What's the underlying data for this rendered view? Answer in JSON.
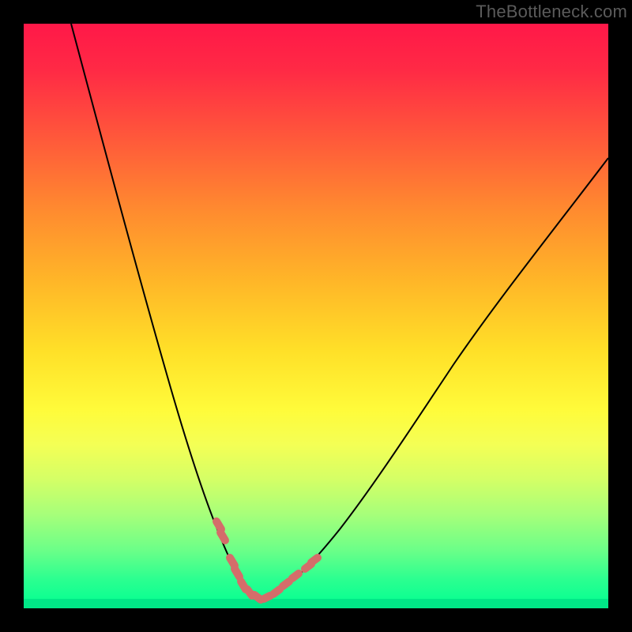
{
  "watermark": "TheBottleneck.com",
  "chart_data": {
    "type": "line",
    "title": "",
    "xlabel": "",
    "ylabel": "",
    "xlim": [
      0,
      740
    ],
    "ylim": [
      0,
      740
    ],
    "grid": false,
    "legend": false,
    "background_gradient": {
      "direction": "vertical",
      "stops": [
        {
          "pos": 0.0,
          "color": "#ff1848"
        },
        {
          "pos": 0.08,
          "color": "#ff2a45"
        },
        {
          "pos": 0.2,
          "color": "#ff5a3a"
        },
        {
          "pos": 0.32,
          "color": "#ff8b2f"
        },
        {
          "pos": 0.44,
          "color": "#ffb628"
        },
        {
          "pos": 0.56,
          "color": "#ffe028"
        },
        {
          "pos": 0.66,
          "color": "#fffb3a"
        },
        {
          "pos": 0.72,
          "color": "#f4ff55"
        },
        {
          "pos": 0.78,
          "color": "#d4ff66"
        },
        {
          "pos": 0.84,
          "color": "#a6ff7a"
        },
        {
          "pos": 0.9,
          "color": "#6cff88"
        },
        {
          "pos": 0.95,
          "color": "#2cff90"
        },
        {
          "pos": 1.0,
          "color": "#00ff92"
        }
      ]
    },
    "series": [
      {
        "name": "v-curve",
        "x": [
          60,
          100,
          140,
          180,
          210,
          235,
          258,
          273,
          286,
          300,
          320,
          350,
          400,
          460,
          520,
          580,
          640,
          700,
          740
        ],
        "y": [
          0,
          150,
          300,
          440,
          540,
          610,
          665,
          698,
          718,
          728,
          720,
          695,
          640,
          555,
          465,
          375,
          290,
          215,
          170
        ]
      }
    ],
    "annotations": {
      "pink_ticks": [
        {
          "x": 247,
          "y": 635
        },
        {
          "x": 252,
          "y": 648
        },
        {
          "x": 264,
          "y": 680
        },
        {
          "x": 270,
          "y": 694
        },
        {
          "x": 278,
          "y": 710
        },
        {
          "x": 286,
          "y": 720
        },
        {
          "x": 296,
          "y": 727
        },
        {
          "x": 308,
          "y": 726
        },
        {
          "x": 320,
          "y": 720
        },
        {
          "x": 332,
          "y": 710
        },
        {
          "x": 344,
          "y": 700
        },
        {
          "x": 360,
          "y": 688
        },
        {
          "x": 368,
          "y": 680
        }
      ]
    }
  }
}
